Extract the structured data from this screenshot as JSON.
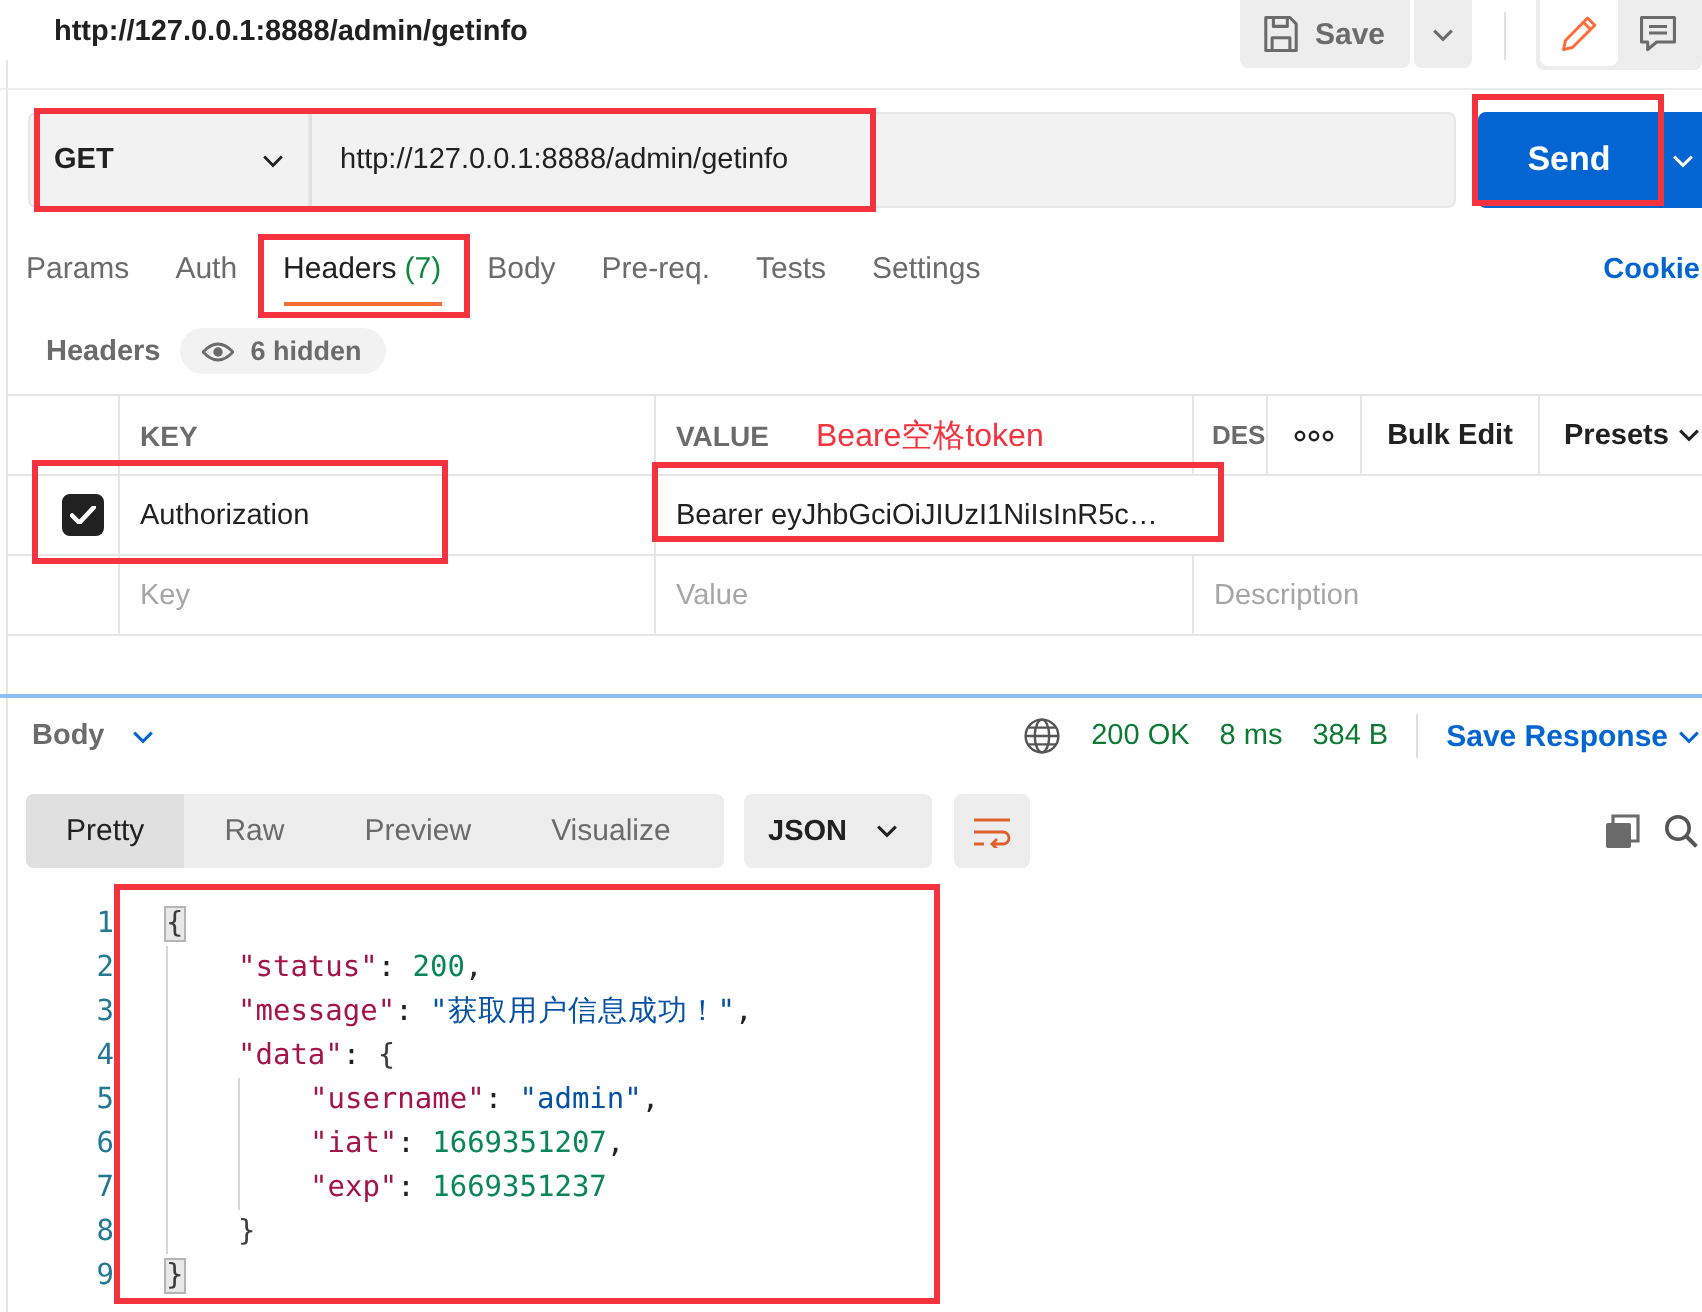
{
  "request_tab": {
    "title": "http://127.0.0.1:8888/admin/getinfo",
    "save_label": "Save",
    "view_modes": [
      {
        "kind": "edit",
        "selected": true
      },
      {
        "kind": "comments",
        "selected": false
      }
    ]
  },
  "request": {
    "method": "GET",
    "url": "http://127.0.0.1:8888/admin/getinfo",
    "send_label": "Send"
  },
  "tabs": [
    {
      "label": "Params",
      "selected": false
    },
    {
      "label": "Auth",
      "selected": false
    },
    {
      "label": "Headers",
      "count": "(7)",
      "selected": true
    },
    {
      "label": "Body",
      "selected": false
    },
    {
      "label": "Pre-req.",
      "selected": false
    },
    {
      "label": "Tests",
      "selected": false
    },
    {
      "label": "Settings",
      "selected": false
    }
  ],
  "cookies_link": "Cookie",
  "headers": {
    "title": "Headers",
    "hidden_badge": "6 hidden",
    "columns": [
      "KEY",
      "VALUE",
      "DES"
    ],
    "bulk_edit": "Bulk Edit",
    "presets": "Presets",
    "rows": [
      {
        "checked": true,
        "key": "Authorization",
        "value": "Bearer eyJhbGciOiJIUzI1NiIsInR5c…"
      }
    ],
    "new_row": {
      "key_placeholder": "Key",
      "value_placeholder": "Value",
      "description_placeholder": "Description"
    }
  },
  "annotations": {
    "note": "Beare空格token"
  },
  "response": {
    "view": "Body",
    "status": "200 OK",
    "time": "8 ms",
    "size": "384 B",
    "save_label": "Save Response",
    "formats": [
      {
        "label": "Pretty",
        "selected": true
      },
      {
        "label": "Raw",
        "selected": false
      },
      {
        "label": "Preview",
        "selected": false
      },
      {
        "label": "Visualize",
        "selected": false
      }
    ],
    "language": "JSON",
    "code": [
      {
        "number": "1",
        "tokens": [
          {
            "kind": "brace",
            "text": "{",
            "matched": true
          }
        ],
        "children": [
          {
            "number": "2",
            "tokens": [
              {
                "kind": "key",
                "text": "\"status\""
              },
              {
                "kind": "colon",
                "text": ":"
              },
              {
                "kind": "number",
                "text": "200"
              },
              {
                "kind": "comma",
                "text": ","
              }
            ]
          },
          {
            "number": "3",
            "tokens": [
              {
                "kind": "key",
                "text": "\"message\""
              },
              {
                "kind": "colon",
                "text": ":"
              },
              {
                "kind": "string",
                "text": "\"获取用户信息成功！\""
              },
              {
                "kind": "comma",
                "text": ","
              }
            ]
          },
          {
            "number": "4",
            "tokens": [
              {
                "kind": "key",
                "text": "\"data\""
              },
              {
                "kind": "colon",
                "text": ":"
              },
              {
                "kind": "brace",
                "text": "{",
                "matched": false
              }
            ],
            "children": [
              {
                "number": "5",
                "tokens": [
                  {
                    "kind": "key",
                    "text": "\"username\""
                  },
                  {
                    "kind": "colon",
                    "text": ":"
                  },
                  {
                    "kind": "string",
                    "text": "\"admin\""
                  },
                  {
                    "kind": "comma",
                    "text": ","
                  }
                ]
              },
              {
                "number": "6",
                "tokens": [
                  {
                    "kind": "key",
                    "text": "\"iat\""
                  },
                  {
                    "kind": "colon",
                    "text": ":"
                  },
                  {
                    "kind": "number",
                    "text": "1669351207"
                  },
                  {
                    "kind": "comma",
                    "text": ","
                  }
                ]
              },
              {
                "number": "7",
                "tokens": [
                  {
                    "kind": "key",
                    "text": "\"exp\""
                  },
                  {
                    "kind": "colon",
                    "text": ":"
                  },
                  {
                    "kind": "number",
                    "text": "1669351237"
                  }
                ]
              }
            ]
          },
          {
            "number": "8",
            "tokens": [
              {
                "kind": "brace",
                "text": "}",
                "matched": false
              }
            ]
          }
        ]
      },
      {
        "number": "9",
        "tokens": [
          {
            "kind": "brace",
            "text": "}",
            "matched": true
          }
        ]
      }
    ]
  }
}
